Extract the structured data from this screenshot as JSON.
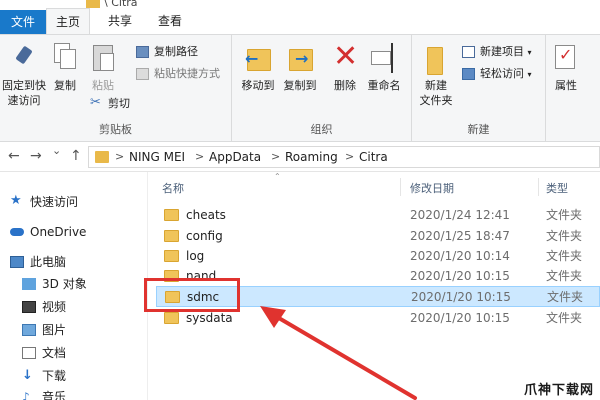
{
  "title_path": "\\ Citra",
  "tabs": {
    "file": "文件",
    "home": "主页",
    "share": "共享",
    "view": "查看"
  },
  "ribbon": {
    "clipboard": {
      "pin_quick_access": "固定到快\n速访问",
      "copy": "复制",
      "paste": "粘贴",
      "copy_path": "复制路径",
      "paste_shortcut": "粘贴快捷方式",
      "cut": "剪切",
      "group_label": "剪贴板"
    },
    "organize": {
      "move_to": "移动到",
      "copy_to": "复制到",
      "delete": "删除",
      "rename": "重命名",
      "group_label": "组织"
    },
    "new": {
      "new_folder": "新建\n文件夹",
      "new_item": "新建项目",
      "easy_access": "轻松访问",
      "group_label": "新建"
    },
    "open": {
      "properties": "属性"
    }
  },
  "address": {
    "back": "←",
    "forward": "→",
    "dropdown": "⌄",
    "up": "↑",
    "crumbs": [
      "NING MEI",
      "AppData",
      "Roaming",
      "Citra"
    ],
    "separator": ">"
  },
  "nav": {
    "quick_access": "快速访问",
    "onedrive": "OneDrive",
    "this_pc": "此电脑",
    "items": [
      "3D 对象",
      "视频",
      "图片",
      "文档",
      "下载",
      "音乐"
    ]
  },
  "list": {
    "headers": {
      "name": "名称",
      "date": "修改日期",
      "type": "类型"
    },
    "rows": [
      {
        "name": "cheats",
        "date": "2020/1/24 12:41",
        "type": "文件夹"
      },
      {
        "name": "config",
        "date": "2020/1/25 18:47",
        "type": "文件夹"
      },
      {
        "name": "log",
        "date": "2020/1/20 10:14",
        "type": "文件夹"
      },
      {
        "name": "nand",
        "date": "2020/1/20 10:15",
        "type": "文件夹"
      },
      {
        "name": "sdmc",
        "date": "2020/1/20 10:15",
        "type": "文件夹",
        "selected": true
      },
      {
        "name": "sysdata",
        "date": "2020/1/20 10:15",
        "type": "文件夹"
      }
    ]
  },
  "watermark": "爪神下载网",
  "colors": {
    "accent": "#1979ca",
    "folder": "#f0c45a",
    "selection": "#cce8ff",
    "annotation": "#e0332f"
  }
}
